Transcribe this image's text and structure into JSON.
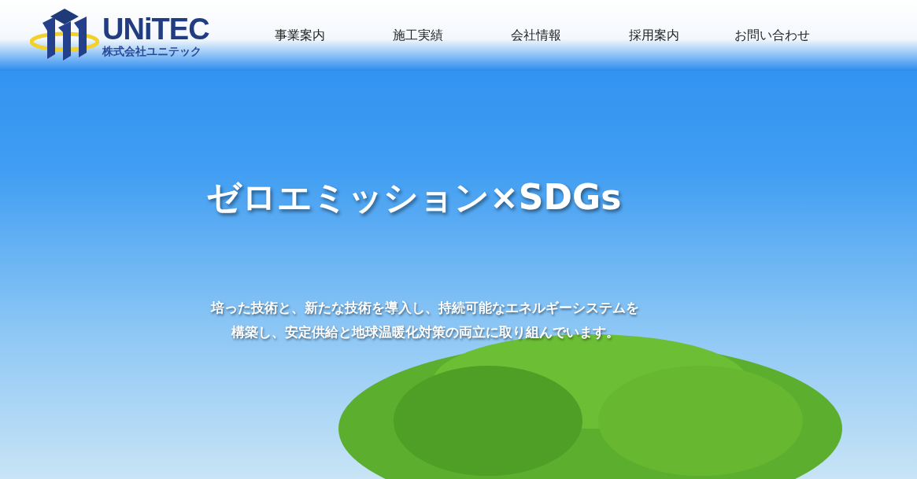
{
  "logo": {
    "wordmark": "UNiTEC",
    "company": "株式会社ユニテック"
  },
  "nav": [
    {
      "label": "事業案内"
    },
    {
      "label": "施工実績"
    },
    {
      "label": "会社情報"
    },
    {
      "label": "採用案内"
    },
    {
      "label": "お問い合わせ"
    }
  ],
  "hero": {
    "title": "ゼロエミッション×SDGs",
    "lead": [
      "培った技術と、新たな技術を導入し、持続可能なエネルギーシステムを",
      "構築し、安定供給と地球温暖化対策の両立に取り組んでいます。"
    ]
  }
}
